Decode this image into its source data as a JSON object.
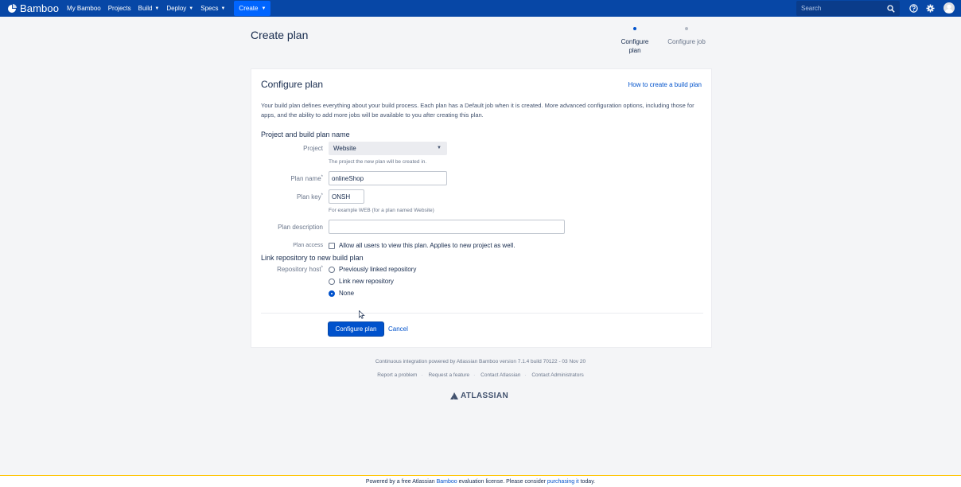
{
  "nav": {
    "logo": "Bamboo",
    "items": [
      {
        "label": "My Bamboo",
        "dropdown": false
      },
      {
        "label": "Projects",
        "dropdown": false
      },
      {
        "label": "Build",
        "dropdown": true
      },
      {
        "label": "Deploy",
        "dropdown": true
      },
      {
        "label": "Specs",
        "dropdown": true
      }
    ],
    "create_label": "Create",
    "search_placeholder": "Search"
  },
  "page": {
    "title": "Create plan",
    "steps": [
      {
        "label": "Configure plan",
        "active": true
      },
      {
        "label": "Configure job",
        "active": false
      }
    ]
  },
  "card": {
    "title": "Configure plan",
    "help_link": "How to create a build plan",
    "intro": "Your build plan defines everything about your build process. Each plan has a Default job when it is created. More advanced configuration options, including those for apps, and the ability to add more jobs will be available to you after creating this plan.",
    "section1_heading": "Project and build plan name",
    "project_label": "Project",
    "project_value": "Website",
    "project_hint": "The project the new plan will be created in.",
    "plan_name_label": "Plan name",
    "plan_name_value": "onlineShop",
    "plan_key_label": "Plan key",
    "plan_key_value": "ONSH",
    "plan_key_hint": "For example WEB (for a plan named Website)",
    "plan_desc_label": "Plan description",
    "plan_desc_value": "",
    "plan_access_label": "Plan access",
    "plan_access_text": "Allow all users to view this plan. Applies to new project as well.",
    "plan_access_checked": false,
    "section2_heading": "Link repository to new build plan",
    "repo_host_label": "Repository host",
    "repo_options": [
      {
        "label": "Previously linked repository",
        "selected": false
      },
      {
        "label": "Link new repository",
        "selected": false
      },
      {
        "label": "None",
        "selected": true
      }
    ],
    "submit_label": "Configure plan",
    "cancel_label": "Cancel"
  },
  "footer": {
    "powered": "Continuous integration powered by Atlassian Bamboo version 7.1.4 build 70122 - 03 Nov 20",
    "links": [
      "Report a problem",
      "Request a feature",
      "Contact Atlassian",
      "Contact Administrators"
    ],
    "brand": "ATLASSIAN"
  },
  "eval_bar": {
    "prefix": "Powered by a free Atlassian",
    "product_link": "Bamboo",
    "middle": "evaluation license. Please consider",
    "purchase_link": "purchasing it",
    "suffix": "today."
  },
  "colors": {
    "nav_bg": "#0747a6",
    "create_bg": "#0065ff",
    "primary": "#0052cc",
    "page_bg": "#f4f5f7"
  }
}
